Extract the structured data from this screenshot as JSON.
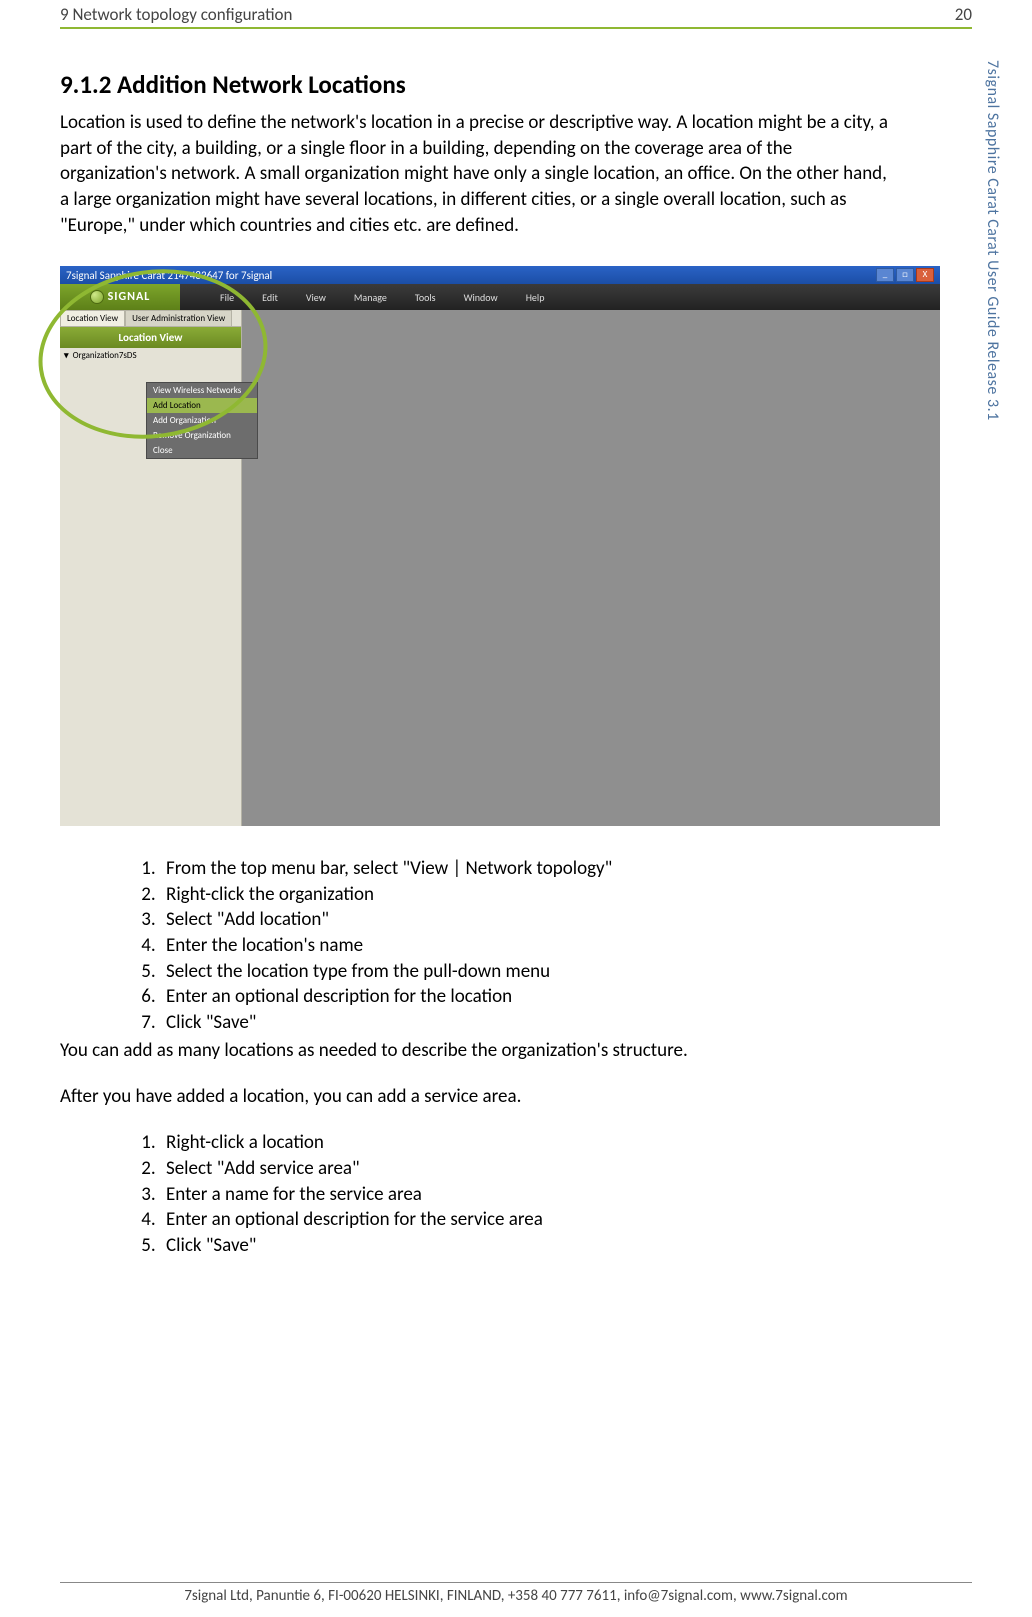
{
  "header": {
    "left": "9 Network topology configuration",
    "right": "20"
  },
  "sidebar_doc_title": "7signal Sapphire Carat Carat User Guide Release 3.1",
  "section": {
    "heading": "9.1.2 Addition Network Locations",
    "intro": "Location is used to define the network's location in a precise or descriptive way. A location might be a city, a part of the city, a building, or a single floor in a building, depending on the coverage area of the organization's network. A small organization might have only a single location, an office. On the other hand, a large organization might have several locations, in different cities, or a single overall location, such as \"Europe,\" under which countries and cities etc. are defined."
  },
  "screenshot": {
    "titlebar": "7signal Sapphire Carat  2147483647 for 7signal",
    "window_buttons": {
      "min": "_",
      "max": "□",
      "close": "X"
    },
    "logo_text": "SIGNAL",
    "menu": [
      "File",
      "Edit",
      "View",
      "Manage",
      "Tools",
      "Window",
      "Help"
    ],
    "tabs": [
      "Location View",
      "User Administration View"
    ],
    "panel_header": "Location View",
    "tree_root": "Organization7sDS",
    "context_menu": [
      "View Wireless Networks",
      "Add Location",
      "Add Organization",
      "Remove Organization",
      "Close"
    ],
    "context_highlight_index": 1
  },
  "steps1": [
    "From the top menu bar, select \"View | Network topology\"",
    "Right-click the organization",
    "Select \"Add location\"",
    "Enter the location's name",
    "Select the location type from the pull-down menu",
    "Enter an optional description for the location",
    "Click \"Save\""
  ],
  "note_after_steps1": "You can add as many locations as needed to describe the organization's structure.",
  "after_text": "After you have added a location, you can add a service area.",
  "steps2": [
    "Right-click a location",
    "Select \"Add service area\"",
    "Enter a name for the service area",
    "Enter an optional description for the service area",
    "Click \"Save\""
  ],
  "footer": "7signal Ltd, Panuntie 6, FI-00620 HELSINKI, FINLAND, +358 40 777 7611, info@7signal.com, www.7signal.com"
}
